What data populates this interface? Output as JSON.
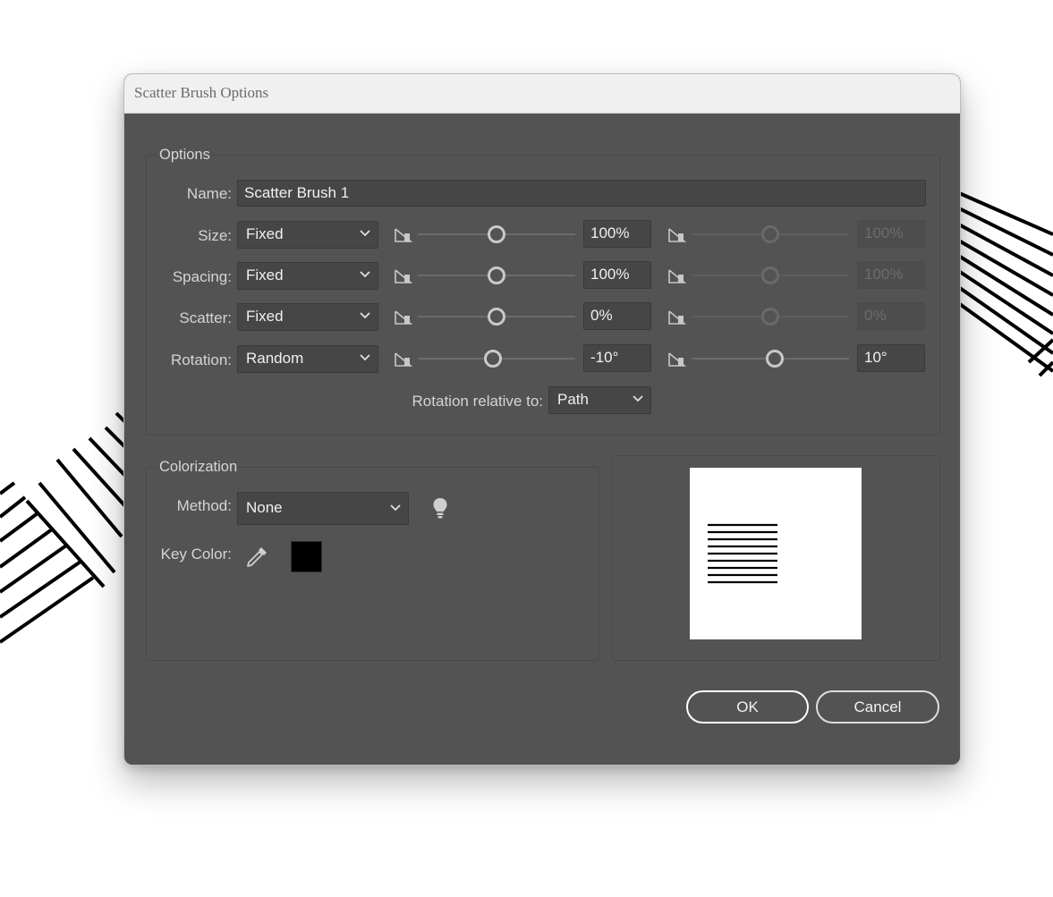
{
  "dialog": {
    "title": "Scatter Brush Options",
    "options_group": {
      "title": "Options",
      "name_label": "Name:",
      "name_value": "Scatter Brush 1",
      "rows": [
        {
          "label": "Size:",
          "mode": "Fixed",
          "min_value": "100%",
          "max_value": "100%",
          "min_level": 0.5,
          "max_level": 0.5,
          "max_enabled": false
        },
        {
          "label": "Spacing:",
          "mode": "Fixed",
          "min_value": "100%",
          "max_value": "100%",
          "min_level": 0.5,
          "max_level": 0.5,
          "max_enabled": false
        },
        {
          "label": "Scatter:",
          "mode": "Fixed",
          "min_value": "0%",
          "max_value": "0%",
          "min_level": 0.5,
          "max_level": 0.5,
          "max_enabled": false
        },
        {
          "label": "Rotation:",
          "mode": "Random",
          "min_value": "-10°",
          "max_value": "10°",
          "min_level": 0.47,
          "max_level": 0.53,
          "max_enabled": true
        }
      ],
      "rotation_relative_label": "Rotation relative to:",
      "rotation_relative_value": "Path"
    },
    "colorization_group": {
      "title": "Colorization",
      "method_label": "Method:",
      "method_value": "None",
      "key_color_label": "Key Color:",
      "key_color": "#000000"
    },
    "buttons": {
      "ok": "OK",
      "cancel": "Cancel"
    }
  },
  "icons": {
    "min_variation": "minimum-variation-icon",
    "max_variation": "maximum-variation-icon",
    "tips": "lightbulb-icon",
    "eyedropper": "eyedropper-icon",
    "dropdown": "chevron-down-icon"
  },
  "colors": {
    "dialog_bg": "#535353",
    "titlebar_bg": "#f0f0f0",
    "field_bg": "#464646",
    "text": "#d4d4d4"
  }
}
